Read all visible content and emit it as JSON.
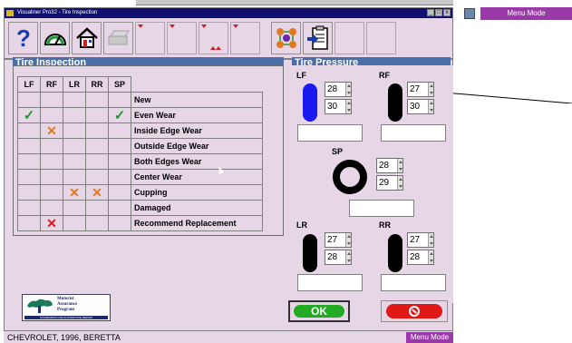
{
  "window": {
    "title": "Visualiner Pro32 - Tire Inspection",
    "menu_mode": "Menu Mode"
  },
  "toolbar": {
    "help_icon": "question-mark-icon",
    "buttons": [
      "help",
      "gauge",
      "home",
      "printer",
      "blank",
      "blank",
      "blank",
      "blank",
      "blank",
      "tire-rotation",
      "clipboard-export",
      "blank",
      "blank"
    ]
  },
  "inspection": {
    "title": "Tire Inspection",
    "columns": [
      "LF",
      "RF",
      "LR",
      "RR",
      "SP"
    ],
    "rows": [
      {
        "label": "New",
        "marks": [
          "",
          "",
          "",
          "",
          ""
        ]
      },
      {
        "label": "Even Wear",
        "marks": [
          "check",
          "",
          "",
          "",
          "check"
        ]
      },
      {
        "label": "Inside Edge Wear",
        "marks": [
          "",
          "x-orange",
          "",
          "",
          ""
        ]
      },
      {
        "label": "Outside Edge Wear",
        "marks": [
          "",
          "",
          "",
          "",
          ""
        ]
      },
      {
        "label": "Both Edges Wear",
        "marks": [
          "",
          "",
          "",
          "",
          ""
        ]
      },
      {
        "label": "Center Wear",
        "marks": [
          "",
          "",
          "",
          "",
          ""
        ]
      },
      {
        "label": "Cupping",
        "marks": [
          "",
          "",
          "x-orange",
          "x-orange",
          ""
        ]
      },
      {
        "label": "Damaged",
        "marks": [
          "",
          "",
          "",
          "",
          ""
        ]
      },
      {
        "label": "Recommend Replacement",
        "marks": [
          "",
          "x-red",
          "",
          "",
          ""
        ]
      }
    ]
  },
  "pressure": {
    "title": "Tire Pressure",
    "lf": {
      "label": "LF",
      "spec": "28",
      "actual": "30"
    },
    "rf": {
      "label": "RF",
      "spec": "27",
      "actual": "30"
    },
    "sp": {
      "label": "SP",
      "spec": "28",
      "actual": "29"
    },
    "lr": {
      "label": "LR",
      "spec": "27",
      "actual": "28"
    },
    "rr": {
      "label": "RR",
      "spec": "27",
      "actual": "28"
    }
  },
  "logo": {
    "line1": "Motorist",
    "line2": "Assurance",
    "line3": "Program",
    "footer": "STANDARDS FOR AUTOMOTIVE REPAIR"
  },
  "buttons": {
    "ok": "OK"
  },
  "status": {
    "vehicle": "CHEVROLET, 1996, BERETTA",
    "mode": "Menu Mode"
  },
  "colors": {
    "accent": "#4a6ea8",
    "window_bg": "#e6d6e6",
    "menu_mode": "#9a3aa8",
    "ok_green": "#22aa22",
    "cancel_red": "#e01818"
  }
}
